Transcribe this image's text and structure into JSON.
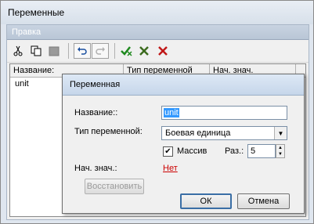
{
  "window": {
    "title": "Переменные"
  },
  "menu": {
    "items": [
      "Правка"
    ]
  },
  "toolbar": {
    "icons": [
      "scissors-icon",
      "copy-icon",
      "paste-icon",
      "undo-icon",
      "redo-icon",
      "check-add-icon",
      "check-cross-icon",
      "delete-icon"
    ]
  },
  "grid": {
    "columns": [
      "Название:",
      "Тип переменной",
      "Нач. знач."
    ],
    "rows": [
      {
        "name": "unit",
        "type": "",
        "value": ""
      }
    ]
  },
  "dialog": {
    "title": "Переменная",
    "name_label": "Название::",
    "name_value": "unit",
    "type_label": "Тип переменной:",
    "type_value": "Боевая единица",
    "array_label": "Массив",
    "array_checked": true,
    "size_label": "Раз.:",
    "size_value": "5",
    "init_label": "Нач. знач.:",
    "init_value": "Нет",
    "restore_label": "Восстановить",
    "ok_label": "ОК",
    "cancel_label": "Отмена"
  }
}
